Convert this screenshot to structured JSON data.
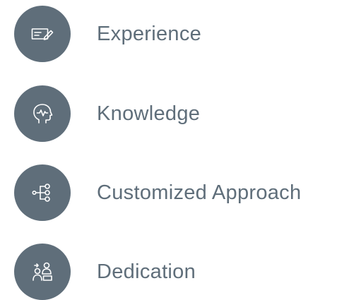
{
  "colors": {
    "icon_background": "#5f6e7a",
    "icon_stroke": "#ffffff",
    "label_text": "#5f6e7a",
    "page_background": "#ffffff"
  },
  "features": [
    {
      "label": "Experience",
      "icon": "certificate-icon"
    },
    {
      "label": "Knowledge",
      "icon": "head-pulse-icon"
    },
    {
      "label": "Customized Approach",
      "icon": "process-tree-icon"
    },
    {
      "label": "Dedication",
      "icon": "team-users-icon"
    }
  ]
}
